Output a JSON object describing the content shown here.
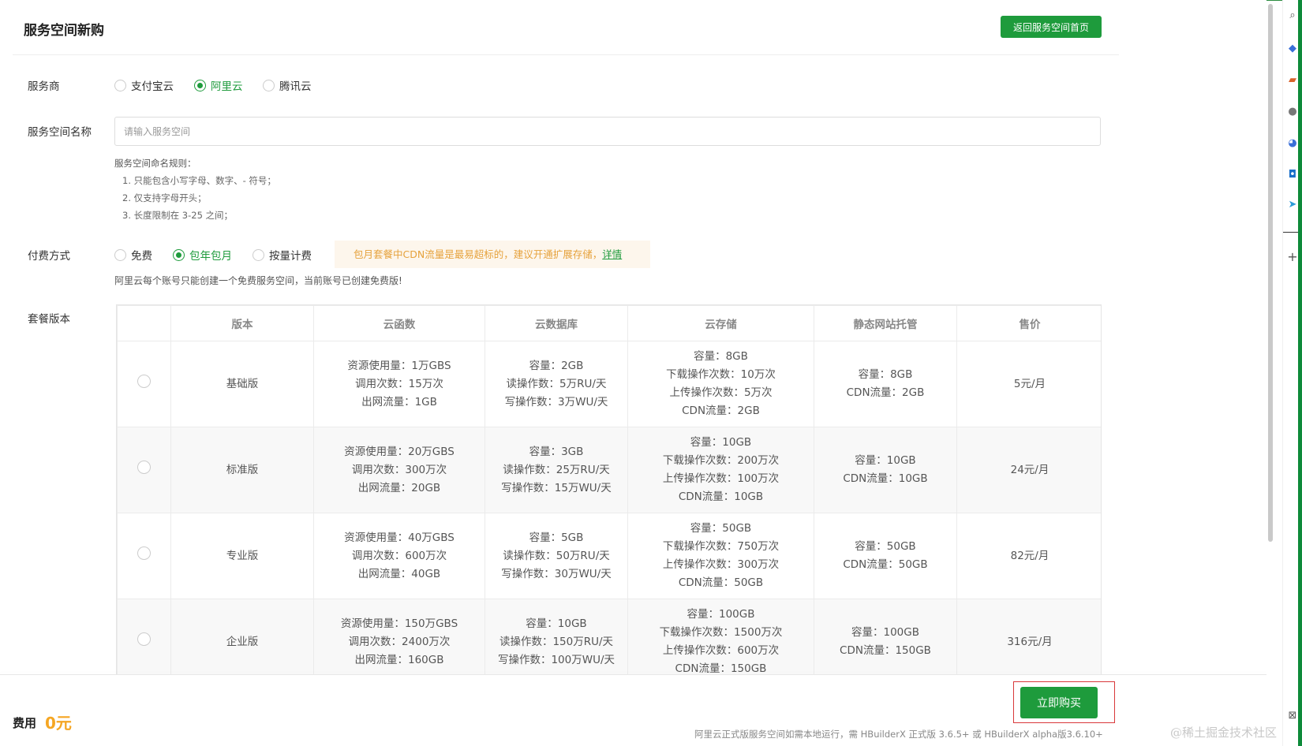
{
  "header": {
    "title": "服务空间新购",
    "back_button": "返回服务空间首页"
  },
  "provider": {
    "label": "服务商",
    "options": [
      "支付宝云",
      "阿里云",
      "腾讯云"
    ],
    "selected": "阿里云"
  },
  "space_name": {
    "label": "服务空间名称",
    "placeholder": "请输入服务空间",
    "value": "",
    "rules_title": "服务空间命名规则：",
    "rules": [
      "1. 只能包含小写字母、数字、- 符号；",
      "2. 仅支持字母开头；",
      "3. 长度限制在 3-25 之间；"
    ]
  },
  "payment": {
    "label": "付费方式",
    "options": [
      "免费",
      "包年包月",
      "按量计费"
    ],
    "selected": "包年包月",
    "notice_text": "包月套餐中CDN流量是最易超标的，建议开通扩展存储，",
    "notice_link": "详情",
    "note": "阿里云每个账号只能创建一个免费服务空间，当前账号已创建免费版!"
  },
  "plans": {
    "label": "套餐版本",
    "columns": [
      "",
      "版本",
      "云函数",
      "云数据库",
      "云存储",
      "静态网站托管",
      "售价"
    ],
    "rows": [
      {
        "name": "基础版",
        "functions": [
          "资源使用量：1万GBS",
          "调用次数：15万次",
          "出网流量：1GB"
        ],
        "database": [
          "容量：2GB",
          "读操作数：5万RU/天",
          "写操作数：3万WU/天"
        ],
        "storage": [
          "容量：8GB",
          "下载操作次数：10万次",
          "上传操作次数：5万次",
          "CDN流量：2GB"
        ],
        "hosting": [
          "容量：8GB",
          "CDN流量：2GB"
        ],
        "price": "5元/月"
      },
      {
        "name": "标准版",
        "functions": [
          "资源使用量：20万GBS",
          "调用次数：300万次",
          "出网流量：20GB"
        ],
        "database": [
          "容量：3GB",
          "读操作数：25万RU/天",
          "写操作数：15万WU/天"
        ],
        "storage": [
          "容量：10GB",
          "下载操作次数：200万次",
          "上传操作次数：100万次",
          "CDN流量：10GB"
        ],
        "hosting": [
          "容量：10GB",
          "CDN流量：10GB"
        ],
        "price": "24元/月"
      },
      {
        "name": "专业版",
        "functions": [
          "资源使用量：40万GBS",
          "调用次数：600万次",
          "出网流量：40GB"
        ],
        "database": [
          "容量：5GB",
          "读操作数：50万RU/天",
          "写操作数：30万WU/天"
        ],
        "storage": [
          "容量：50GB",
          "下载操作次数：750万次",
          "上传操作次数：300万次",
          "CDN流量：50GB"
        ],
        "hosting": [
          "容量：50GB",
          "CDN流量：50GB"
        ],
        "price": "82元/月"
      },
      {
        "name": "企业版",
        "functions": [
          "资源使用量：150万GBS",
          "调用次数：2400万次",
          "出网流量：160GB"
        ],
        "database": [
          "容量：10GB",
          "读操作数：150万RU/天",
          "写操作数：100万WU/天"
        ],
        "storage": [
          "容量：100GB",
          "下载操作次数：1500万次",
          "上传操作次数：600万次",
          "CDN流量：150GB"
        ],
        "hosting": [
          "容量：100GB",
          "CDN流量：150GB"
        ],
        "price": "316元/月"
      }
    ]
  },
  "footer": {
    "fee_label": "费用",
    "fee_value": "0元",
    "buy_button": "立即购买",
    "note": "阿里云正式版服务空间如需本地运行，需 HBuilderX 正式版 3.6.5+ 或 HBuilderX alpha版3.6.10+"
  },
  "watermark": "@稀土掘金技术社区",
  "colors": {
    "accent": "#1e9b3c",
    "fee": "#f5a623",
    "notice_bg": "#fdf6ec",
    "notice_text": "#e6a23c",
    "highlight_border": "#d9383a"
  },
  "right_toolbar_icons": [
    "search-icon",
    "tag-icon",
    "briefcase-icon",
    "users-icon",
    "chrome-icon",
    "outlook-icon",
    "send-icon",
    "plus-icon",
    "screenshot-icon"
  ]
}
